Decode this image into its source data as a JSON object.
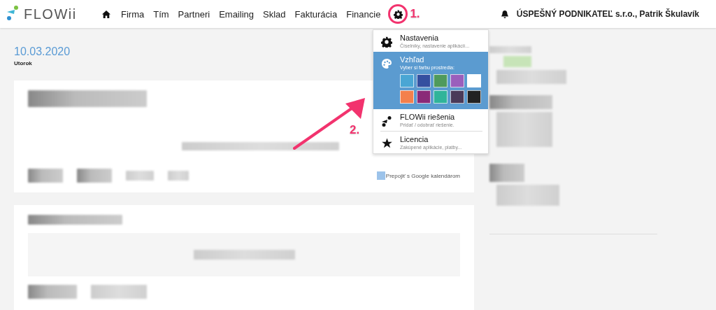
{
  "header": {
    "logo": "FLOWii",
    "nav": [
      {
        "label": "Firma"
      },
      {
        "label": "Tím"
      },
      {
        "label": "Partneri"
      },
      {
        "label": "Emailing"
      },
      {
        "label": "Sklad"
      },
      {
        "label": "Fakturácia"
      },
      {
        "label": "Financie"
      }
    ],
    "account": "ÚSPEŠNÝ PODNIKATEĽ s.r.o., Patrik Škulavík"
  },
  "date": {
    "value": "10.03.2020",
    "weekday": "Utorok"
  },
  "calendar_link": "Prepojiť s Google kalendárom",
  "menu": [
    {
      "kind": "settings",
      "title": "Nastavenia",
      "subtitle": "Číselníky, nastavenie aplikácií...",
      "selected": false
    },
    {
      "kind": "appearance",
      "title": "Vzhľad",
      "subtitle": "Vyber si farbu prostredia:",
      "selected": true,
      "swatches": [
        {
          "color": "#4aa6d4"
        },
        {
          "color": "#3550a0"
        },
        {
          "color": "#4f9a5c"
        },
        {
          "color": "#9a5fbc"
        },
        {
          "color": "#ffffff"
        },
        {
          "color": "#f4804c"
        },
        {
          "color": "#8a2a78"
        },
        {
          "color": "#30b49a"
        },
        {
          "color": "#4a3a58"
        },
        {
          "color": "#222222"
        }
      ]
    },
    {
      "kind": "solutions",
      "title": "FLOWii riešenia",
      "subtitle": "Pridať / odobrať riešenie.",
      "selected": false
    },
    {
      "kind": "license",
      "title": "Licencia",
      "subtitle": "Zakúpené aplikácie, platby...",
      "selected": false
    }
  ],
  "annotations": [
    {
      "label": "1."
    },
    {
      "label": "2."
    }
  ]
}
